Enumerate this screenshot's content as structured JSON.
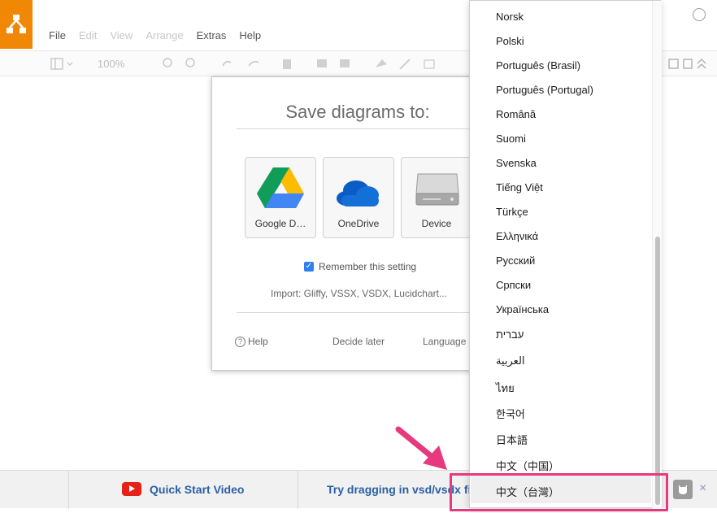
{
  "app": {
    "menu": [
      "File",
      "Edit",
      "View",
      "Arrange",
      "Extras",
      "Help"
    ],
    "toolbar_zoom": "100%"
  },
  "dialog": {
    "title": "Save diagrams to:",
    "options": [
      {
        "label": "Google D…",
        "icon": "google-drive-icon"
      },
      {
        "label": "OneDrive",
        "icon": "onedrive-icon"
      },
      {
        "label": "Device",
        "icon": "device-icon"
      }
    ],
    "remember_label": "Remember this setting",
    "remember_checked": true,
    "import_text": "Import: Gliffy, VSSX, VSDX, Lucidchart...",
    "help_label": "Help",
    "decide_later_label": "Decide later",
    "language_label": "Language"
  },
  "language_menu": {
    "items": [
      "Norsk",
      "Polski",
      "Português (Brasil)",
      "Português (Portugal)",
      "Română",
      "Suomi",
      "Svenska",
      "Tiếng Việt",
      "Türkçe",
      "Ελληνικά",
      "Русский",
      "Српски",
      "Українська",
      "עברית",
      "العربية",
      "ไทย",
      "한국어",
      "日本語",
      "中文（中国）",
      "中文（台灣）"
    ],
    "selected": "中文（台灣）"
  },
  "banner": {
    "quick_start_label": "Quick Start Video",
    "try_text": "Try dragging in vsd/vsdx files",
    "close_label": "×"
  },
  "colors": {
    "accent": "#f08705",
    "link": "#2a5fa3",
    "highlight": "#e7397e",
    "checkbox": "#2f7ff0"
  }
}
